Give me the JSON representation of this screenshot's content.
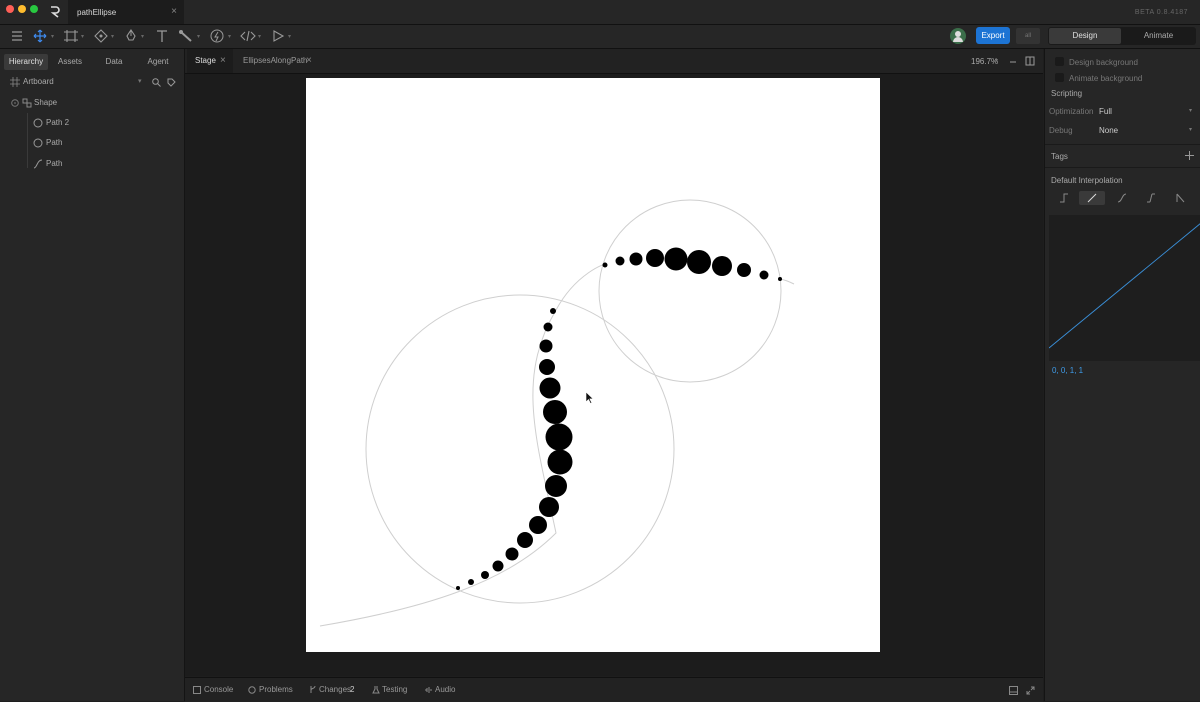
{
  "window": {
    "document_tab": "pathEllipse",
    "close_glyph": "×",
    "version": "BETA 0.8.4187",
    "traffic_colors": [
      "#fe5f57",
      "#febc2e",
      "#28c840"
    ]
  },
  "toolbar": {
    "tools": [
      "menu-icon",
      "move-icon",
      "frame-icon",
      "component-icon",
      "pen-icon",
      "text-icon",
      "bone-icon",
      "bolt-icon",
      "code-icon",
      "play-icon"
    ],
    "export_label": "Export",
    "mini_badge": "all",
    "tab_design": "Design",
    "tab_animate": "Animate",
    "accent": "#1d74d4"
  },
  "left_panel": {
    "tabs": [
      "Hierarchy",
      "Assets",
      "Data",
      "Agent"
    ],
    "artboard_label": "Artboard",
    "tree": [
      {
        "label": "Shape",
        "icon": "shape-group-icon"
      },
      {
        "label": "Path 2",
        "icon": "ellipse-icon"
      },
      {
        "label": "Path",
        "icon": "ellipse-icon"
      },
      {
        "label": "Path",
        "icon": "path-icon"
      }
    ]
  },
  "stage": {
    "tabs": [
      "Stage",
      "EllipsesAlongPath"
    ],
    "zoom": "196.7%"
  },
  "bottom_bar": {
    "items": [
      "Console",
      "Problems",
      "Changes",
      "Testing",
      "Audio"
    ],
    "changes_count": "2"
  },
  "right_panel": {
    "design_background": "Design background",
    "animate_background": "Animate background",
    "scripting": "Scripting",
    "optimization_label": "Optimization",
    "optimization_value": "Full",
    "debug_label": "Debug",
    "debug_value": "None",
    "tags_label": "Tags",
    "interpolation_label": "Default Interpolation",
    "interpolation_value": "0, 0, 1, 1"
  }
}
